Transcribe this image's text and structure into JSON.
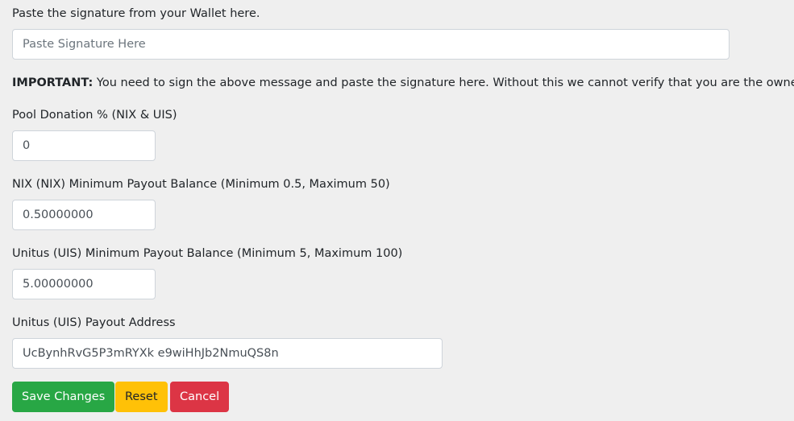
{
  "signature": {
    "label": "Paste the signature from your Wallet here.",
    "placeholder": "Paste Signature Here",
    "value": ""
  },
  "important": {
    "prefix": "IMPORTANT:",
    "text": " You need to sign the above message and paste the signature here. Without this we cannot verify that you are the owner."
  },
  "donation": {
    "label": "Pool Donation % (NIX & UIS)",
    "value": "0"
  },
  "nix_payout": {
    "label": "NIX (NIX) Minimum Payout Balance (Minimum 0.5, Maximum 50)",
    "value": "0.50000000"
  },
  "uis_payout": {
    "label": "Unitus (UIS) Minimum Payout Balance (Minimum 5, Maximum 100)",
    "value": "5.00000000"
  },
  "uis_address": {
    "label": "Unitus (UIS) Payout Address",
    "value": "UcBynhRvG5P3mRYXk e9wiHhJb2NmuQS8n"
  },
  "buttons": {
    "save": "Save Changes",
    "reset": "Reset",
    "cancel": "Cancel"
  },
  "colors": {
    "save": "#28a745",
    "reset": "#ffc107",
    "cancel": "#dc3545",
    "background": "#efefef"
  }
}
